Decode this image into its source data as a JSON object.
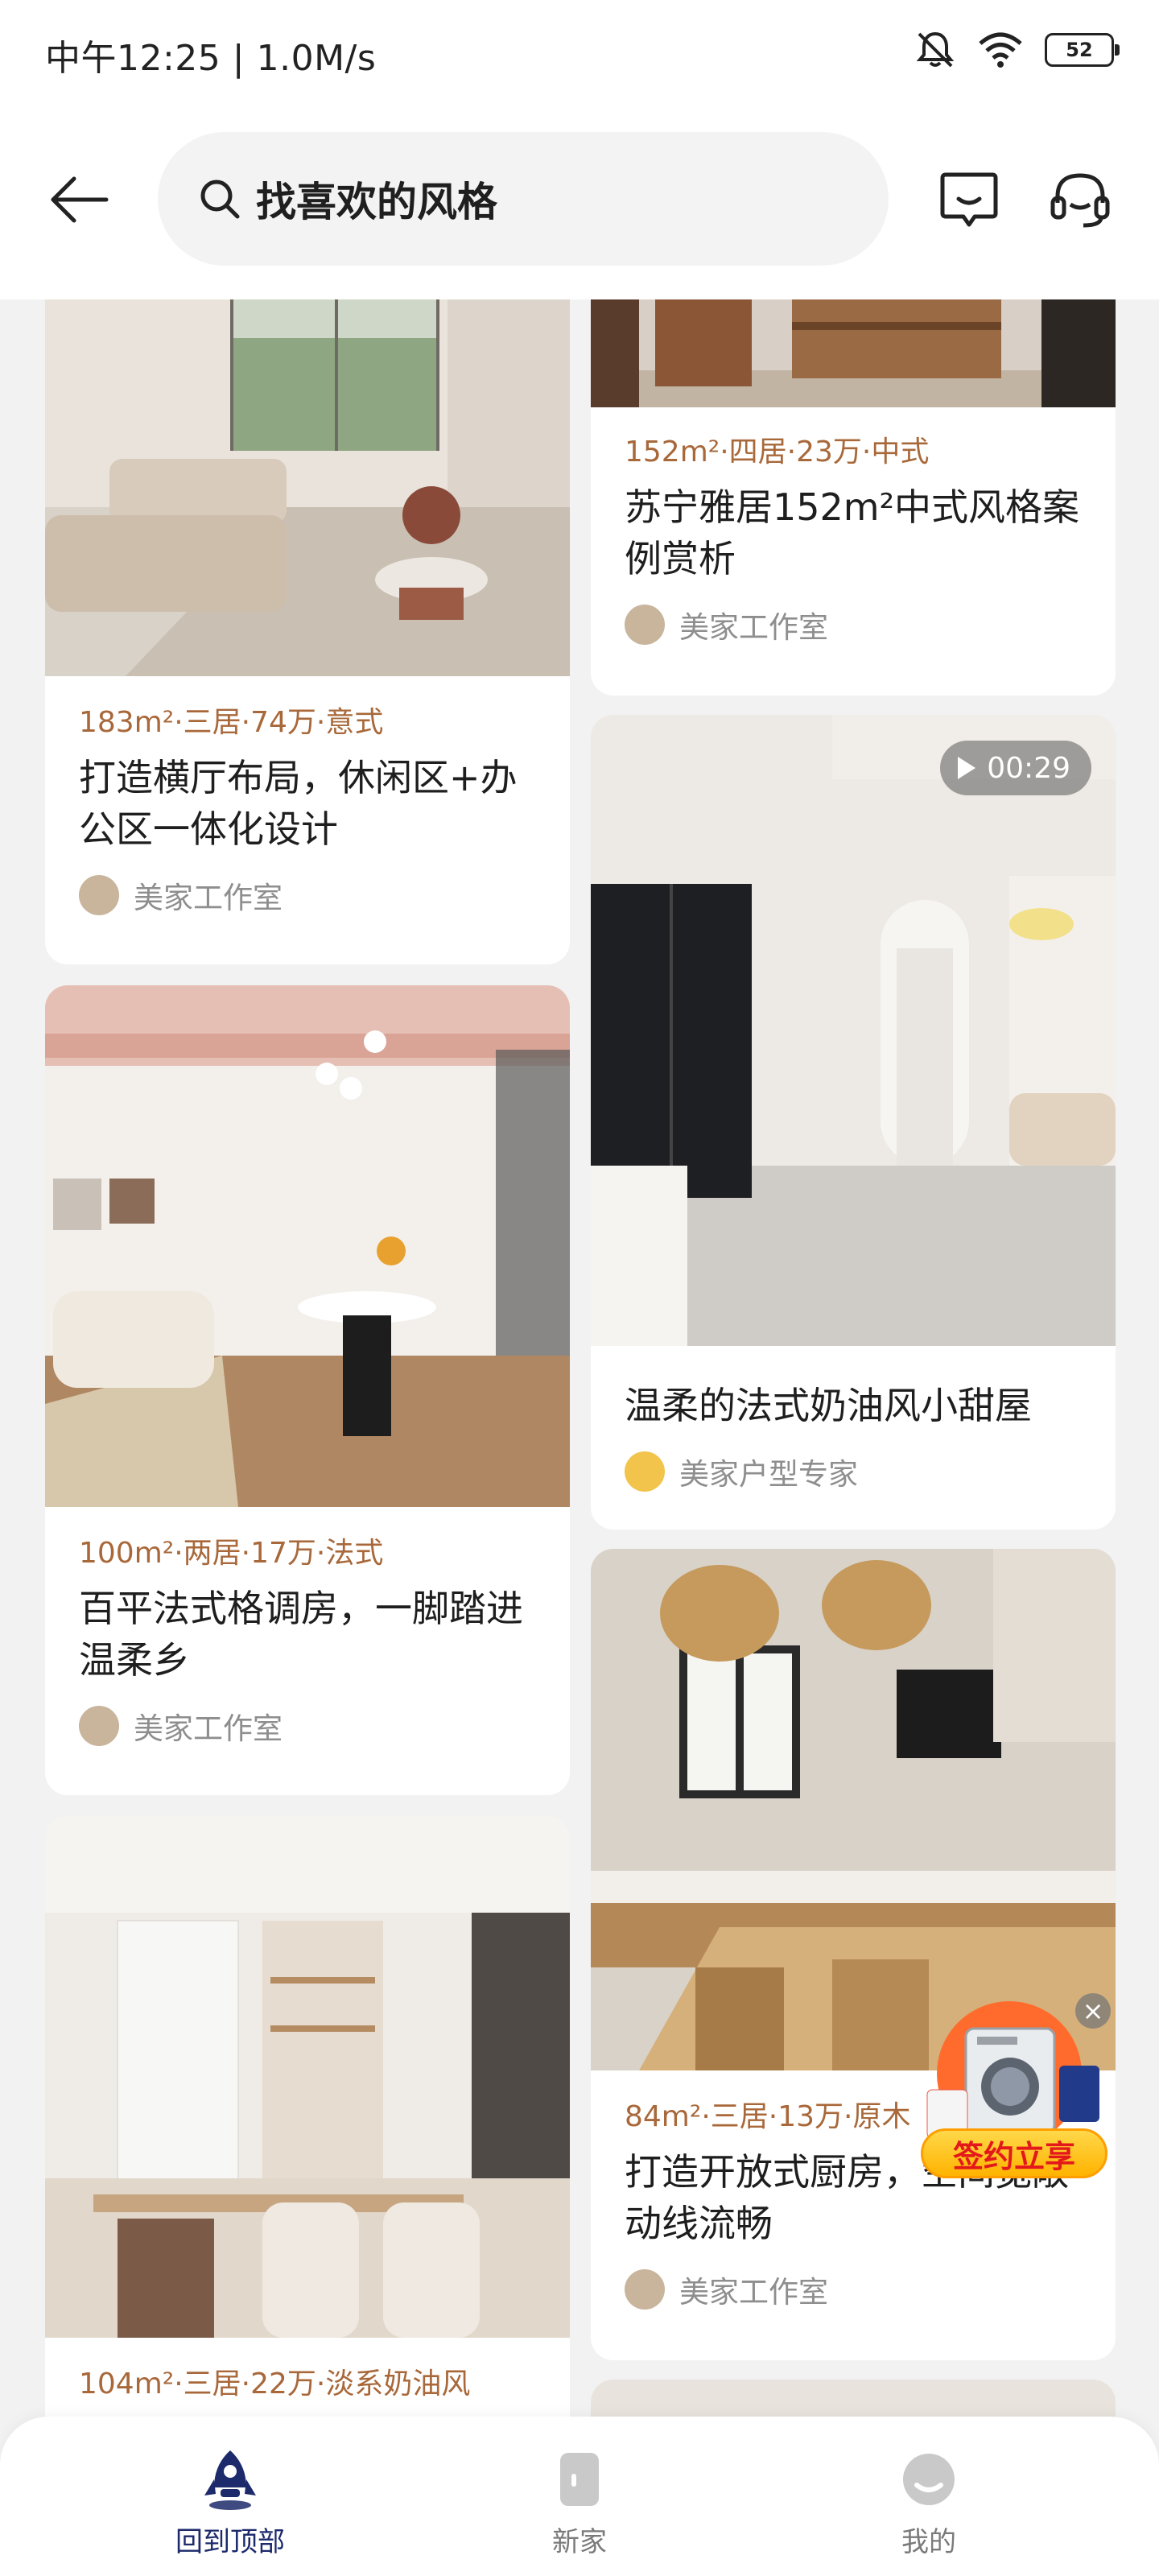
{
  "status_bar": {
    "time": "中午12:25 | 1.0M/s",
    "battery": "52"
  },
  "header": {
    "search_text": "找喜欢的风格"
  },
  "cards": {
    "c1": {
      "meta": "",
      "title": "打造横厅布局，休闲区+办公区一体化设计",
      "author": "美家工作室",
      "meta_parts": {
        "area": "183m²",
        "rest": "·三居·74万·意式"
      }
    },
    "c2": {
      "meta_parts": {
        "area": "100m²",
        "rest": "·两居·17万·法式"
      },
      "title": "百平法式格调房，一脚踏进温柔乡",
      "author": "美家工作室"
    },
    "c3": {
      "meta_parts": {
        "area": "104m²",
        "rest": "·三居·22万·淡系奶油风"
      }
    },
    "c4": {
      "meta_parts": {
        "area": "152m²",
        "rest": "·四居·23万·中式"
      },
      "title": "苏宁雅居152m²中式风格案例赏析",
      "author": "美家工作室"
    },
    "c5": {
      "video_duration": "00:29",
      "title": "温柔的法式奶油风小甜屋",
      "author": "美家户型专家"
    },
    "c6": {
      "meta_parts": {
        "area": "84m²",
        "rest": "·三居·13万·原木"
      },
      "title": "打造开放式厨房，空间宽敞动线流畅",
      "author": "美家工作室"
    }
  },
  "promo": {
    "label": "签约立享",
    "close": "×"
  },
  "bottom_nav": [
    {
      "label": "回到顶部",
      "icon": "rocket-icon",
      "active": true
    },
    {
      "label": "新家",
      "icon": "door-icon",
      "active": false
    },
    {
      "label": "我的",
      "icon": "profile-icon",
      "active": false
    }
  ],
  "colors": {
    "meta": "#a8683a",
    "accent": "#1d2a6b",
    "promo": "#e3181b"
  }
}
